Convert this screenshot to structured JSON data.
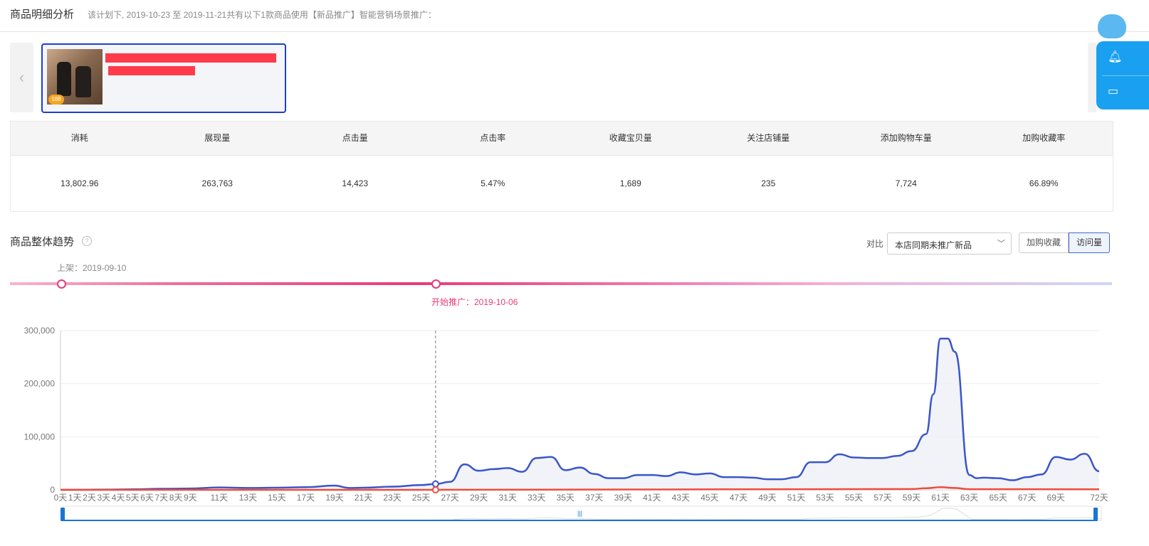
{
  "header": {
    "title": "商品明细分析",
    "subtitle": "该计划下, 2019-10-23 至 2019-11-21共有以下1款商品使用【新品推广】智能营销场景推广："
  },
  "product": {
    "badge": "188"
  },
  "stats": {
    "headers": [
      "消耗",
      "展现量",
      "点击量",
      "点击率",
      "收藏宝贝量",
      "关注店铺量",
      "添加购物车量",
      "加购收藏率"
    ],
    "values": [
      "13,802.96",
      "263,763",
      "14,423",
      "5.47%",
      "1,689",
      "235",
      "7,724",
      "66.89%"
    ]
  },
  "trend": {
    "title": "商品整体趋势",
    "compare_label": "对比",
    "compare_value": "本店同期未推广新品",
    "buttons": [
      "加购收藏",
      "访问量"
    ],
    "active_button": "访问量",
    "launch_label": "上架：2019-09-10",
    "start_label": "开始推广：2019-10-06",
    "start_day": 26
  },
  "colors": {
    "accent": "#3a56c8",
    "compare": "#f04b3a",
    "timeline": "#e63b78",
    "panel": "#1aa0f0"
  },
  "chart_data": {
    "type": "line",
    "x_unit": "天",
    "xlim": [
      0,
      72
    ],
    "ylim": [
      0,
      300000
    ],
    "yticks": [
      "0",
      "100,000",
      "200,000",
      "300,000"
    ],
    "xticks": [
      "0天",
      "1天",
      "2天",
      "3天",
      "4天",
      "5天",
      "6天",
      "7天",
      "8天",
      "9天",
      "11天",
      "13天",
      "15天",
      "17天",
      "19天",
      "21天",
      "23天",
      "25天",
      "27天",
      "29天",
      "31天",
      "33天",
      "35天",
      "37天",
      "39天",
      "41天",
      "43天",
      "45天",
      "47天",
      "49天",
      "51天",
      "53天",
      "55天",
      "57天",
      "59天",
      "61天",
      "63天",
      "65天",
      "67天",
      "69天",
      "72天"
    ],
    "series": [
      {
        "color": "#3a56c8",
        "points": [
          [
            0,
            0
          ],
          [
            3,
            500
          ],
          [
            5,
            1000
          ],
          [
            7,
            2000
          ],
          [
            9,
            2500
          ],
          [
            11,
            4500
          ],
          [
            13,
            3500
          ],
          [
            15,
            4000
          ],
          [
            17,
            5000
          ],
          [
            19,
            8000
          ],
          [
            20,
            3500
          ],
          [
            21,
            4000
          ],
          [
            23,
            6000
          ],
          [
            25,
            9000
          ],
          [
            26,
            11000
          ],
          [
            27,
            15000
          ],
          [
            28,
            48000
          ],
          [
            29,
            36000
          ],
          [
            30,
            39000
          ],
          [
            31,
            41000
          ],
          [
            32,
            34000
          ],
          [
            33,
            60000
          ],
          [
            34,
            62000
          ],
          [
            35,
            37000
          ],
          [
            36,
            42000
          ],
          [
            37,
            30000
          ],
          [
            38,
            22000
          ],
          [
            39,
            22000
          ],
          [
            40,
            28000
          ],
          [
            41,
            28000
          ],
          [
            42,
            26000
          ],
          [
            43,
            33000
          ],
          [
            44,
            29000
          ],
          [
            45,
            31000
          ],
          [
            46,
            24000
          ],
          [
            47,
            24000
          ],
          [
            48,
            23000
          ],
          [
            49,
            20000
          ],
          [
            50,
            20000
          ],
          [
            51,
            24000
          ],
          [
            52,
            52000
          ],
          [
            53,
            52000
          ],
          [
            54,
            67000
          ],
          [
            55,
            61000
          ],
          [
            56,
            60000
          ],
          [
            57,
            60000
          ],
          [
            58,
            64000
          ],
          [
            59,
            73000
          ],
          [
            60,
            105000
          ],
          [
            60.5,
            180000
          ],
          [
            61,
            285000
          ],
          [
            61.5,
            285000
          ],
          [
            62,
            260000
          ],
          [
            63,
            28000
          ],
          [
            63.5,
            22000
          ],
          [
            64,
            23000
          ],
          [
            65,
            22000
          ],
          [
            66,
            18000
          ],
          [
            67,
            24000
          ],
          [
            68,
            29000
          ],
          [
            69,
            62000
          ],
          [
            70,
            57000
          ],
          [
            71,
            68000
          ],
          [
            72,
            35000
          ]
        ]
      },
      {
        "color": "#f04b3a",
        "points": [
          [
            0,
            0
          ],
          [
            25,
            0
          ],
          [
            59,
            1500
          ],
          [
            60,
            3000
          ],
          [
            61,
            5000
          ],
          [
            62,
            3500
          ],
          [
            63,
            1200
          ],
          [
            72,
            1000
          ]
        ]
      }
    ]
  }
}
